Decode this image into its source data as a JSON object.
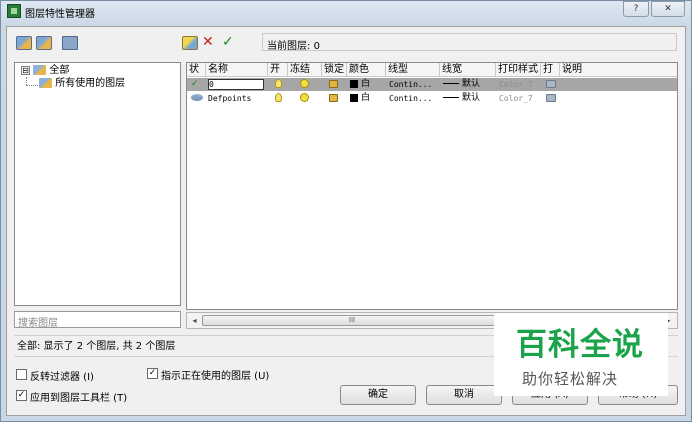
{
  "window": {
    "title": "图层特性管理器",
    "help_button": "?",
    "close_button": "✕"
  },
  "toolbar": {
    "current_layer_label": "当前图层:",
    "current_layer_value": "0"
  },
  "tree": {
    "root_label": "全部",
    "child_label": "所有使用的图层",
    "expander": "⊟"
  },
  "search": {
    "placeholder": "搜索图层"
  },
  "grid": {
    "columns": [
      "状",
      "名称",
      "开",
      "冻结",
      "锁定",
      "颜色",
      "线型",
      "线宽",
      "打印样式",
      "打",
      "说明"
    ],
    "rows": [
      {
        "status": "✓",
        "name": "0",
        "color": "白",
        "linetype": "Contin...",
        "lineweight": "默认",
        "plot_style": "Color_7",
        "selected": true
      },
      {
        "status": "",
        "name": "Defpoints",
        "color": "白",
        "linetype": "Contin...",
        "lineweight": "默认",
        "plot_style": "Color_7",
        "selected": false
      }
    ]
  },
  "scrollbar": {
    "left_arrow": "◂",
    "right_arrow": "▸",
    "thumb_grip": "III"
  },
  "status_bar": {
    "text": "全部: 显示了 2 个图层, 共 2 个图层"
  },
  "options": {
    "invert_filter": {
      "label": "反转过滤器 (I)",
      "checked": false
    },
    "indicate_in_use": {
      "label": "指示正在使用的图层 (U)",
      "checked": true
    },
    "apply_to_toolbar": {
      "label": "应用到图层工具栏 (T)",
      "checked": true
    }
  },
  "buttons": {
    "ok": "确定",
    "cancel": "取消",
    "apply": "应用 (A)",
    "help": "帮助 (H)"
  },
  "watermark": {
    "title": "百科全说",
    "subtitle": "助你轻松解决"
  },
  "colors": {
    "watermark_green": "#1aa34a",
    "selected_row": "#a6a6a6"
  }
}
